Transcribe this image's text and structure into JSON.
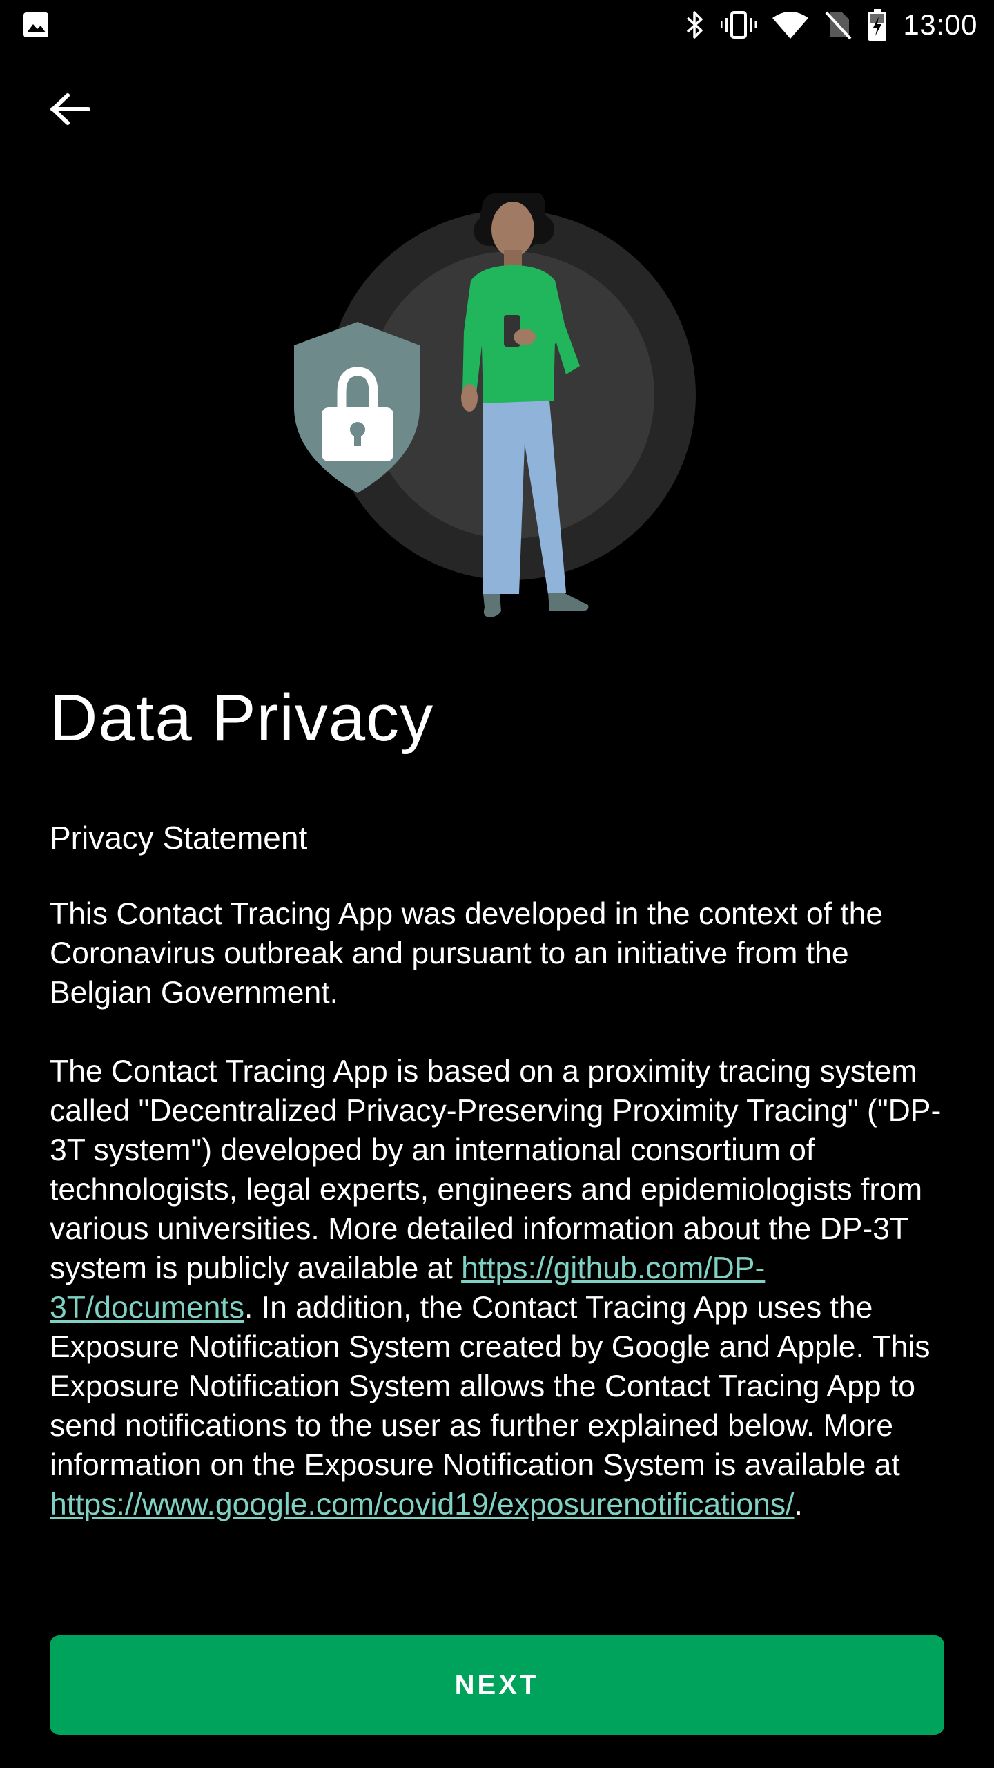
{
  "status_bar": {
    "time": "13:00",
    "icons": [
      "image-notification-icon",
      "bluetooth-icon",
      "vibrate-icon",
      "wifi-icon",
      "no-sim-icon",
      "battery-charging-icon"
    ]
  },
  "nav": {
    "back_icon": "arrow-back-icon"
  },
  "illustration": {
    "icons": [
      "shield-lock-icon",
      "person-with-phone-illustration"
    ]
  },
  "page": {
    "title": "Data Privacy",
    "section_heading": "Privacy Statement",
    "paragraph1": "This Contact Tracing App was developed in the context of the Coronavirus outbreak and pursuant to an initiative from the Belgian Government.",
    "paragraph2_part1": "The Contact Tracing App is based on a proximity tracing system called \"Decentralized Privacy-Preserving Proximity Tracing\" (\"DP-3T system\") developed by an international consortium of technologists, legal experts, engineers and epidemiologists from various universities. More detailed information about the DP-3T system is publicly available at ",
    "link1": "https://github.com/DP-3T/documents",
    "paragraph2_part2": ". In addition, the Contact Tracing App uses the Exposure Notification System created by Google and Apple. This Exposure Notification System allows the Contact Tracing App to send notifications to the user as further explained below. More information on the Exposure Notification System is available at ",
    "link2": "https://www.google.com/covid19/exposurenotifications/",
    "paragraph2_part3": "."
  },
  "actions": {
    "next_label": "NEXT"
  },
  "colors": {
    "background": "#000000",
    "accent_button": "#00a35c",
    "link": "#7fd2c3",
    "shield": "#6f8a8b",
    "shirt": "#22b65c",
    "jeans": "#8fb3d9"
  }
}
